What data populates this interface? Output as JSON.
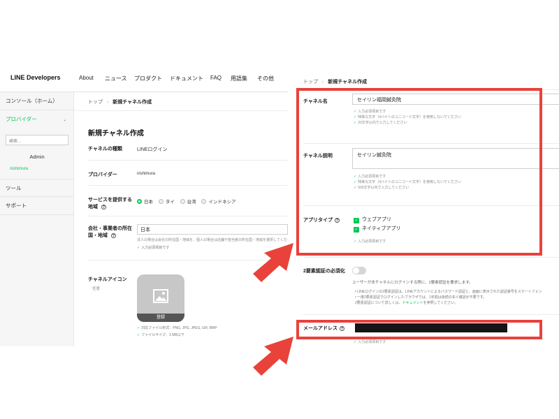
{
  "colors": {
    "accent": "#06c755",
    "highlight": "#e8423b"
  },
  "left": {
    "brand": "LINE Developers",
    "nav": [
      "About",
      "ニュース",
      "プロダクト",
      "ドキュメント",
      "FAQ",
      "用語集",
      "その他"
    ],
    "sidebar": {
      "console": "コンソール（ホーム）",
      "providers": "プロバイダー",
      "search_placeholder": "検索...",
      "admin": "Admin",
      "user": "nishimura",
      "tools": "ツール",
      "support": "サポート"
    },
    "breadcrumb": {
      "home": "トップ",
      "sep": "›",
      "current": "新規チャネル作成"
    },
    "title": "新規チャネル作成",
    "fields": {
      "channel_type_label": "チャネルの種類",
      "channel_type_value": "LINEログイン",
      "provider_label": "プロバイダー",
      "provider_value": "nishimura",
      "region_label": "サービスを提供する地域",
      "regions": [
        "日本",
        "タイ",
        "台湾",
        "インドネシア"
      ],
      "company_label": "会社・事業者の所在国・地域",
      "company_value": "日本",
      "company_hint": "法人の場合は会社の所在国・地域を、個人の場合は店舗や担当者の所在国・地域を選択してください",
      "required": "入力必須項目です",
      "icon_label": "チャネルアイコン",
      "icon_optional": "任意",
      "icon_button": "登録",
      "icon_req1": "対応ファイル形式：PNG, JPG, JPEG, GIF, BMP",
      "icon_req2": "ファイルサイズ：3 MB以下"
    }
  },
  "right": {
    "breadcrumb": {
      "home": "トップ",
      "sep": "›",
      "current": "新規チャネル作成"
    },
    "channel_name_label": "チャネル名",
    "channel_name_value": "セイリン福岡鍼灸院",
    "channel_desc_label": "チャネル説明",
    "channel_desc_value": "セイリン鍼灸院",
    "req_required": "入力必須項目です",
    "req_no_special": "特殊な文字（4バイトのユニコード文字）を使用しないでください",
    "req_len_name": "20文字以内で入力してください",
    "req_len_desc": "500文字以内で入力してください",
    "app_type_label": "アプリタイプ",
    "app_types": [
      "ウェブアプリ",
      "ネイティブアプリ"
    ],
    "twofa_label": "2要素認証の必須化",
    "twofa_desc": "ユーザーが本チャネルにログインする際に、2要素認証を要求します。",
    "twofa_note1": "LINEログインの2要素認証は、LINEアカウントによるパスワード認証と、画面に表示された認証番号をスマートフォン",
    "twofa_note2": "一度2要素認証でログインしたブラウザでは、1年間は後続の本人確認が不要です。",
    "twofa_note3": "2要素認証について詳しくは、",
    "twofa_link": "ドキュメント",
    "twofa_note4": "を参照してください。",
    "email_label": "メールアドレス",
    "email_req": "入力必須項目です"
  }
}
